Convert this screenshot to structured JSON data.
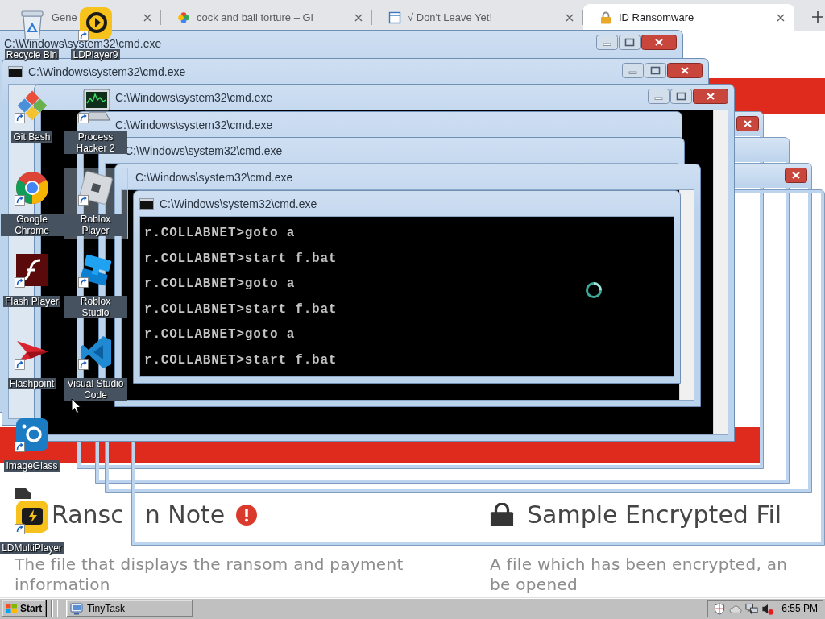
{
  "browser": {
    "tabs": [
      {
        "title": "Gene",
        "kind": "plain",
        "selected": false
      },
      {
        "title": "cock and ball torture – Gi",
        "kind": "pinwheel",
        "selected": false
      },
      {
        "title": "√ Don't Leave Yet!",
        "kind": "document",
        "selected": false
      },
      {
        "title": "ID Ransomware",
        "kind": "padlock",
        "selected": true
      }
    ]
  },
  "page": {
    "sections": [
      {
        "kind": "note",
        "heading_parts": [
          "Ransc",
          "n Note"
        ],
        "alert": true,
        "description": [
          "The file that displays the ransom and payment",
          "information"
        ]
      },
      {
        "kind": "sample",
        "heading_parts": [
          "Sample Encrypted Fil"
        ],
        "alert": false,
        "description": [
          "A file which has been encrypted, an",
          "be opened"
        ]
      }
    ]
  },
  "console_windows": [
    {
      "title": "C:\\Windows\\system32\\cmd.exe"
    },
    {
      "title": "C:\\Windows\\system32\\cmd.exe"
    },
    {
      "title": "C:\\Windows\\system32\\cmd.exe"
    },
    {
      "title": "C:\\Windows\\system32\\cmd.exe"
    },
    {
      "title": "C:\\Windows\\system32\\cmd.exe"
    },
    {
      "title": "C:\\Windows\\system32\\cmd.exe"
    },
    {
      "title": "C:\\Windows\\system32\\cmd.exe",
      "lines": [
        "r.COLLABNET>goto a",
        "r.COLLABNET>start f.bat",
        "r.COLLABNET>goto a",
        "r.COLLABNET>start f.bat",
        "r.COLLABNET>goto a",
        "r.COLLABNET>start f.bat"
      ]
    }
  ],
  "desktop_icons": [
    {
      "label": "Recycle Bin",
      "kind": "recyclebin",
      "shortcut": false,
      "selected": false
    },
    {
      "label": "Git Bash",
      "kind": "gitbash",
      "shortcut": true,
      "selected": false
    },
    {
      "label": "Google Chrome",
      "kind": "chrome",
      "shortcut": true,
      "selected": false
    },
    {
      "label": "Flash Player",
      "kind": "flash",
      "shortcut": true,
      "selected": false
    },
    {
      "label": "Flashpoint",
      "kind": "flashpoint",
      "shortcut": true,
      "selected": false
    },
    {
      "label": "ImageGlass",
      "kind": "imageglass",
      "shortcut": true,
      "selected": false
    },
    {
      "label": "LDMultiPlayer",
      "kind": "ldmulti",
      "shortcut": true,
      "selected": false
    },
    {
      "label": "LDPlayer9",
      "kind": "ldplayer",
      "shortcut": true,
      "selected": false
    },
    {
      "label": "Process Hacker 2",
      "kind": "processhacker",
      "shortcut": true,
      "selected": false
    },
    {
      "label": "Roblox Player",
      "kind": "robloxplayer",
      "shortcut": true,
      "selected": true
    },
    {
      "label": "Roblox Studio",
      "kind": "robloxstudio",
      "shortcut": true,
      "selected": false
    },
    {
      "label": "Visual Studio Code",
      "kind": "vscode",
      "shortcut": true,
      "selected": false
    }
  ],
  "taskbar": {
    "start": "Start",
    "tasks": [
      {
        "label": "TinyTask",
        "selected": false
      }
    ],
    "volume_muted": true,
    "clock": "6:55 PM"
  }
}
